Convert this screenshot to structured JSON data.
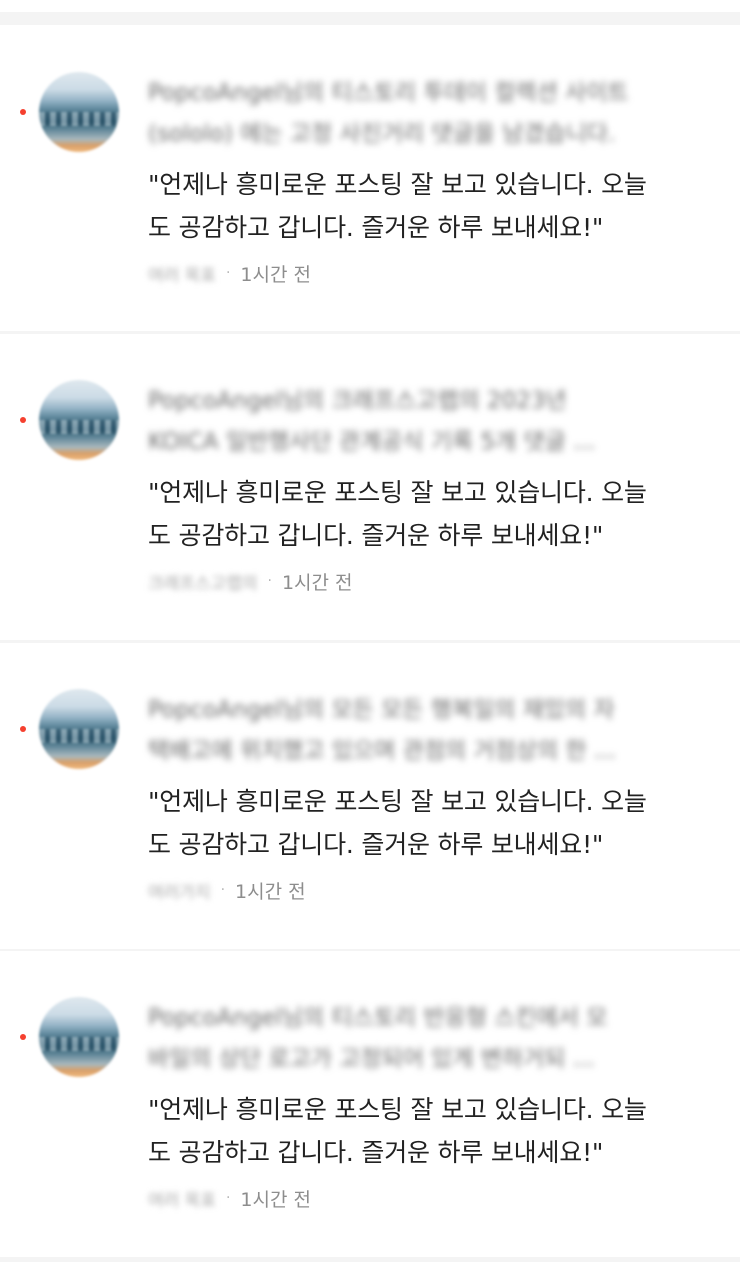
{
  "notifications": [
    {
      "blurred_title_line1": "PopcoAngel님의 티스토리 투데이 컬렉션 사이트",
      "blurred_title_line2": "(sololo) 에는 고정 사진거리 댓글을 남겼습니다.",
      "comment": "\"언제나 흥미로운 포스팅 잘 보고 있습니다. 오늘\n도 공감하고 갑니다. 즐거운 하루 보내세요!\"",
      "comment_line1": "\"언제나 흥미로운 포스팅 잘 보고 있습니다. 오늘",
      "comment_line2": "도 공감하고 갑니다. 즐거운 하루 보내세요!\"",
      "blurred_author": "여러 목표",
      "time": "1시간 전"
    },
    {
      "blurred_title_line1": "PopcoAngel님의 크래프스고랩의 2023년",
      "blurred_title_line2": "KOICA 일반행사단 관계공식 기록 5개 댓글 ...",
      "comment_line1": "\"언제나 흥미로운 포스팅 잘 보고 있습니다. 오늘",
      "comment_line2": "도 공감하고 갑니다. 즐거운 하루 보내세요!\"",
      "blurred_author": "크래프스고랩의",
      "time": "1시간 전"
    },
    {
      "blurred_title_line1": "PopcoAngel님의 모든 모든 행복일의 재밌의 자",
      "blurred_title_line2": "택배고에 위치했고 있으며 관점의 거점상의 한 ...",
      "comment_line1": "\"언제나 흥미로운 포스팅 잘 보고 있습니다. 오늘",
      "comment_line2": "도 공감하고 갑니다. 즐거운 하루 보내세요!\"",
      "blurred_author": "여러가지",
      "time": "1시간 전"
    },
    {
      "blurred_title_line1": "PopcoAngel님의 티스토리 반응형 스킨에서 모",
      "blurred_title_line2": "바일의 상단 로고가 고정되어 있게 변하거되 ...",
      "comment_line1": "\"언제나 흥미로운 포스팅 잘 보고 있습니다. 오늘",
      "comment_line2": "도 공감하고 갑니다. 즐거운 하루 보내세요!\"",
      "blurred_author": "여러 목표",
      "time": "1시간 전"
    }
  ],
  "meta_separator": "·",
  "colors": {
    "unread_dot": "#f5402f",
    "comment_text": "#222222",
    "meta_text": "#8d8d8d",
    "background": "#f4f4f4",
    "card": "#ffffff"
  }
}
